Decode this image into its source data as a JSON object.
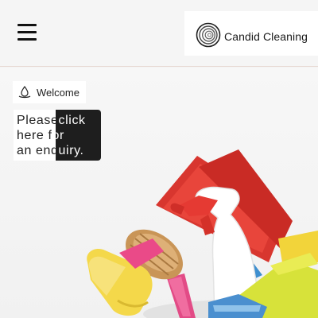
{
  "header": {
    "menu_icon": "hamburger-icon",
    "brand": {
      "name": "Candid Cleaning",
      "logo_icon": "spiral-logo-icon"
    }
  },
  "hero": {
    "image": "cleaning-supplies-photo",
    "welcome": {
      "icon": "water-drop-icon",
      "label": "Welcome"
    },
    "enquiry": {
      "line1_a": "Please",
      "line1_b": "click",
      "line2_a": "here f",
      "line2_b": "or",
      "line3_a": "an enq",
      "line3_b": "uiry."
    }
  },
  "colors": {
    "dark_panel": "#1e1e1e",
    "header_border": "#e7d9d3"
  }
}
